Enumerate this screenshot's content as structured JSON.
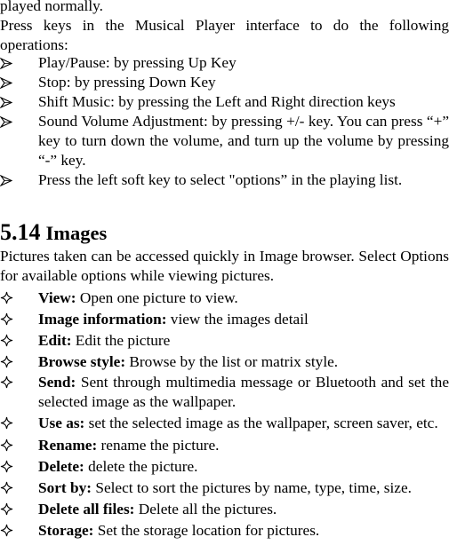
{
  "document": {
    "continuation_text": "played normally.",
    "music_intro": "Press keys in the Musical Player interface to do the following operations:",
    "music_operations": [
      {
        "text": "Play/Pause: by pressing Up Key"
      },
      {
        "text": "Stop: by pressing Down Key"
      },
      {
        "text": "Shift Music: by pressing the Left and Right direction keys"
      },
      {
        "text": "Sound Volume Adjustment: by pressing +/- key. You can press “+” key to turn down the volume, and turn up the volume by pressing “-” key."
      },
      {
        "text": "Press the left soft key to select \"options” in the playing list."
      }
    ],
    "section": {
      "number": "5.14",
      "title": "Images",
      "intro": "Pictures taken can be accessed quickly in Image browser. Select Options for available options while viewing pictures.",
      "options": [
        {
          "term": "View:",
          "description": " Open one picture to view."
        },
        {
          "term": "Image information:",
          "description": " view the images detail"
        },
        {
          "term": "Edit:",
          "description": " Edit the picture"
        },
        {
          "term": "Browse style:",
          "description": " Browse by the list or matrix style."
        },
        {
          "term": "Send:",
          "description": " Sent through multimedia message or Bluetooth and set the selected image as the wallpaper."
        },
        {
          "term": "Use as:",
          "description": " set the selected image as the wallpaper, screen saver, etc."
        },
        {
          "term": "Rename:",
          "description": " rename the picture."
        },
        {
          "term": "Delete:",
          "description": " delete the picture."
        },
        {
          "term": "Sort by:",
          "description": " Select to sort the pictures by name, type, time, size."
        },
        {
          "term": "Delete all files:",
          "description": " Delete all the pictures."
        },
        {
          "term": "Storage:",
          "description": " Set the storage location for pictures."
        }
      ]
    },
    "icons": {
      "arrow_bullet": "arrowhead-bullet-icon",
      "diamond_bullet": "four-point-star-bullet-icon"
    }
  }
}
